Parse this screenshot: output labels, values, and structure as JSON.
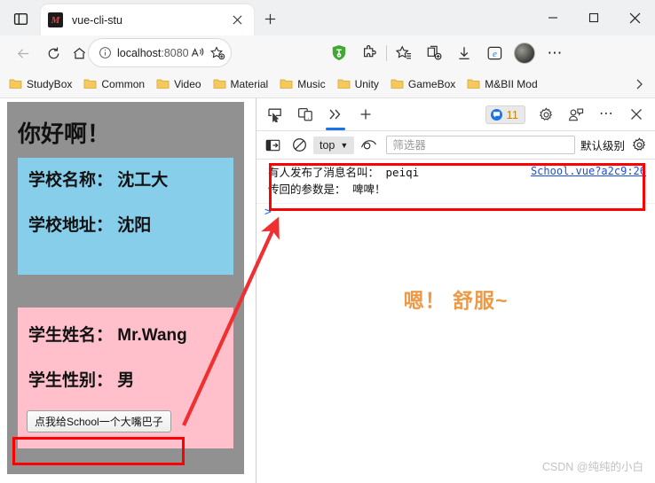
{
  "window": {
    "tab": {
      "title": "vue-cli-stu",
      "favicon": "markdown-icon",
      "favicon_letter": "M"
    },
    "controls": {
      "minimize": "─",
      "maximize": "☐",
      "close": "✕"
    },
    "tab_strip_icon": "tab-actions-icon",
    "new_tab_label": "+"
  },
  "nav": {
    "back": "back-arrow-icon",
    "reload": "reload-icon",
    "home": "home-icon",
    "address": {
      "prefix": "localhost",
      "suffix": ":8080",
      "full": "localhost:8080",
      "info_icon": "site-info-icon"
    },
    "read_aloud": "read-aloud-icon",
    "favorite": "add-favorite-icon",
    "extensions": [
      {
        "name": "adguard-icon",
        "color": "#41a836"
      },
      {
        "name": "puzzle-extension-icon",
        "color": "#2b2b2b"
      },
      {
        "name": "collections-icon",
        "color": "#2b2b2b"
      },
      {
        "name": "split-screen-icon",
        "color": "#2b2b2b"
      },
      {
        "name": "downloads-icon",
        "color": "#2b2b2b"
      },
      {
        "name": "ie-mode-icon",
        "color": "#1b7ec2"
      }
    ],
    "profile": "avatar",
    "more": "⋯"
  },
  "bookmarks": {
    "items": [
      {
        "label": "StudyBox"
      },
      {
        "label": "Common"
      },
      {
        "label": "Video"
      },
      {
        "label": "Material"
      },
      {
        "label": "Music"
      },
      {
        "label": "Unity"
      },
      {
        "label": "GameBox"
      },
      {
        "label": "M&BII Mod"
      }
    ],
    "overflow": "›"
  },
  "page": {
    "greeting": "你好啊！",
    "school_card": {
      "name_line": "学校名称： 沈工大",
      "address_line": "学校地址： 沈阳",
      "bg": "#87ceeb"
    },
    "student_card": {
      "name_line": "学生姓名： Mr.Wang",
      "gender_line": "学生性别： 男",
      "button_label": "点我给School一个大嘴巴子",
      "bg": "#ffc0cb"
    },
    "body_bg": "#919191"
  },
  "devtools": {
    "toolbar": {
      "inspect": "inspect-element-icon",
      "device_toolbar": "device-toolbar-icon",
      "more_panels": "»",
      "add_panel": "+",
      "message_count": "11",
      "settings": "gear-icon",
      "customize": "devtools-customize-icon",
      "more_options": "⋯",
      "close": "✕"
    },
    "filterbar": {
      "sidebar_toggle": "console-sidebar-icon",
      "clear": "clear-console-icon",
      "context": "top",
      "context_caret": "▼",
      "live_expression": "eye-icon",
      "filter_placeholder": "筛选器",
      "level_label": "默认级别",
      "settings": "gear-icon"
    },
    "console": {
      "entries": [
        {
          "line1": "有人发布了消息名叫：  peiqi",
          "line2": "传回的参数是：  啤啤！",
          "source": "School.vue?a2c9:26"
        }
      ],
      "prompt": ">"
    }
  },
  "annotations": {
    "orange_note": "嗯！ 舒服~",
    "orange_color": "#ee9944",
    "highlight_color": "#ff0000",
    "arrow_color": "#f03030"
  },
  "watermark": "CSDN @纯纯的小白"
}
